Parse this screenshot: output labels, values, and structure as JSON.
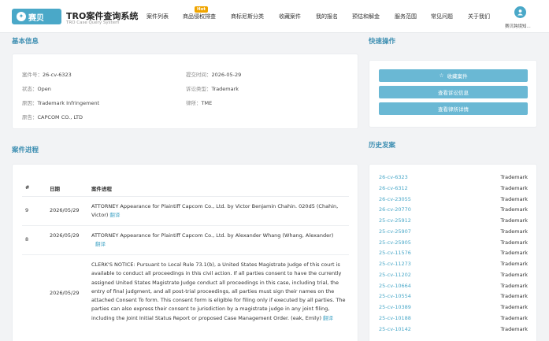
{
  "header": {
    "logo_text": "赛贝",
    "title": "TRO案件查询系统",
    "subtitle": "TRO Case Query System",
    "hot_badge": "Hot",
    "nav": [
      "案件列表",
      "商品侵权排查",
      "商标尼斯分类",
      "收藏案件",
      "我的报名",
      "预估和解金",
      "服务范围",
      "常见问题",
      "关于我们"
    ],
    "username": "赛贝跨境知..."
  },
  "basic_info": {
    "section_title": "基本信息",
    "case_no_label": "案件号：",
    "case_no": "26-cv-6323",
    "filed_label": "提交时间：",
    "filed": "2026-05-29",
    "status_label": "状态：",
    "status": "Open",
    "type_label": "诉讼类型：",
    "type": "Trademark",
    "cause_label": "原因：",
    "cause": "Trademark Infringement",
    "firm_label": "律所：",
    "firm": "TME",
    "plaintiff_label": "原告：",
    "plaintiff": "CAPCOM CO., LTD"
  },
  "quick_actions": {
    "section_title": "快速操作",
    "favorite": "收藏案件",
    "view_defendants": "查看诉讼信息",
    "view_firm": "查看律所详情"
  },
  "progress": {
    "section_title": "案件进程",
    "headers": [
      "#",
      "日期",
      "案件进程"
    ],
    "translate_label": "翻译",
    "rows": [
      {
        "num": "9",
        "date": "2026/05/29",
        "text": "ATTORNEY Appearance for Plaintiff Capcom Co., Ltd. by Victor Benjamin Chahin. 020d5 (Chahin, Victor)"
      },
      {
        "num": "8",
        "date": "2026/05/29",
        "text": "ATTORNEY Appearance for Plaintiff Capcom Co., Ltd. by Alexander Whang (Whang, Alexander)"
      },
      {
        "num": "",
        "date": "2026/05/29",
        "text": "CLERK'S NOTICE: Pursuant to Local Rule 73.1(b), a United States Magistrate Judge of this court is available to conduct all proceedings in this civil action. If all parties consent to have the currently assigned United States Magistrate Judge conduct all proceedings in this case, including trial, the entry of final judgment, and all post-trial proceedings, all parties must sign their names on the attached Consent To form. This consent form is eligible for filing only if executed by all parties. The parties can also express their consent to jurisdiction by a magistrate judge in any joint filing, including the Joint Initial Status Report or proposed Case Management Order. (eak, Emily)"
      }
    ]
  },
  "history": {
    "section_title": "历史发案",
    "items": [
      {
        "case": "26-cv-6323",
        "type": "Trademark"
      },
      {
        "case": "26-cv-6312",
        "type": "Trademark"
      },
      {
        "case": "26-cv-23055",
        "type": "Trademark"
      },
      {
        "case": "26-cv-20770",
        "type": "Trademark"
      },
      {
        "case": "25-cv-25912",
        "type": "Trademark"
      },
      {
        "case": "25-cv-25907",
        "type": "Trademark"
      },
      {
        "case": "25-cv-25905",
        "type": "Trademark"
      },
      {
        "case": "25-cv-11576",
        "type": "Trademark"
      },
      {
        "case": "25-cv-11273",
        "type": "Trademark"
      },
      {
        "case": "25-cv-11202",
        "type": "Trademark"
      },
      {
        "case": "25-cv-10664",
        "type": "Trademark"
      },
      {
        "case": "25-cv-10554",
        "type": "Trademark"
      },
      {
        "case": "25-cv-10389",
        "type": "Trademark"
      },
      {
        "case": "25-cv-10188",
        "type": "Trademark"
      },
      {
        "case": "25-cv-10142",
        "type": "Trademark"
      }
    ]
  },
  "colors": {
    "accent": "#4aa8c8",
    "button": "#6ab8d4",
    "hot": "#f0a500"
  }
}
